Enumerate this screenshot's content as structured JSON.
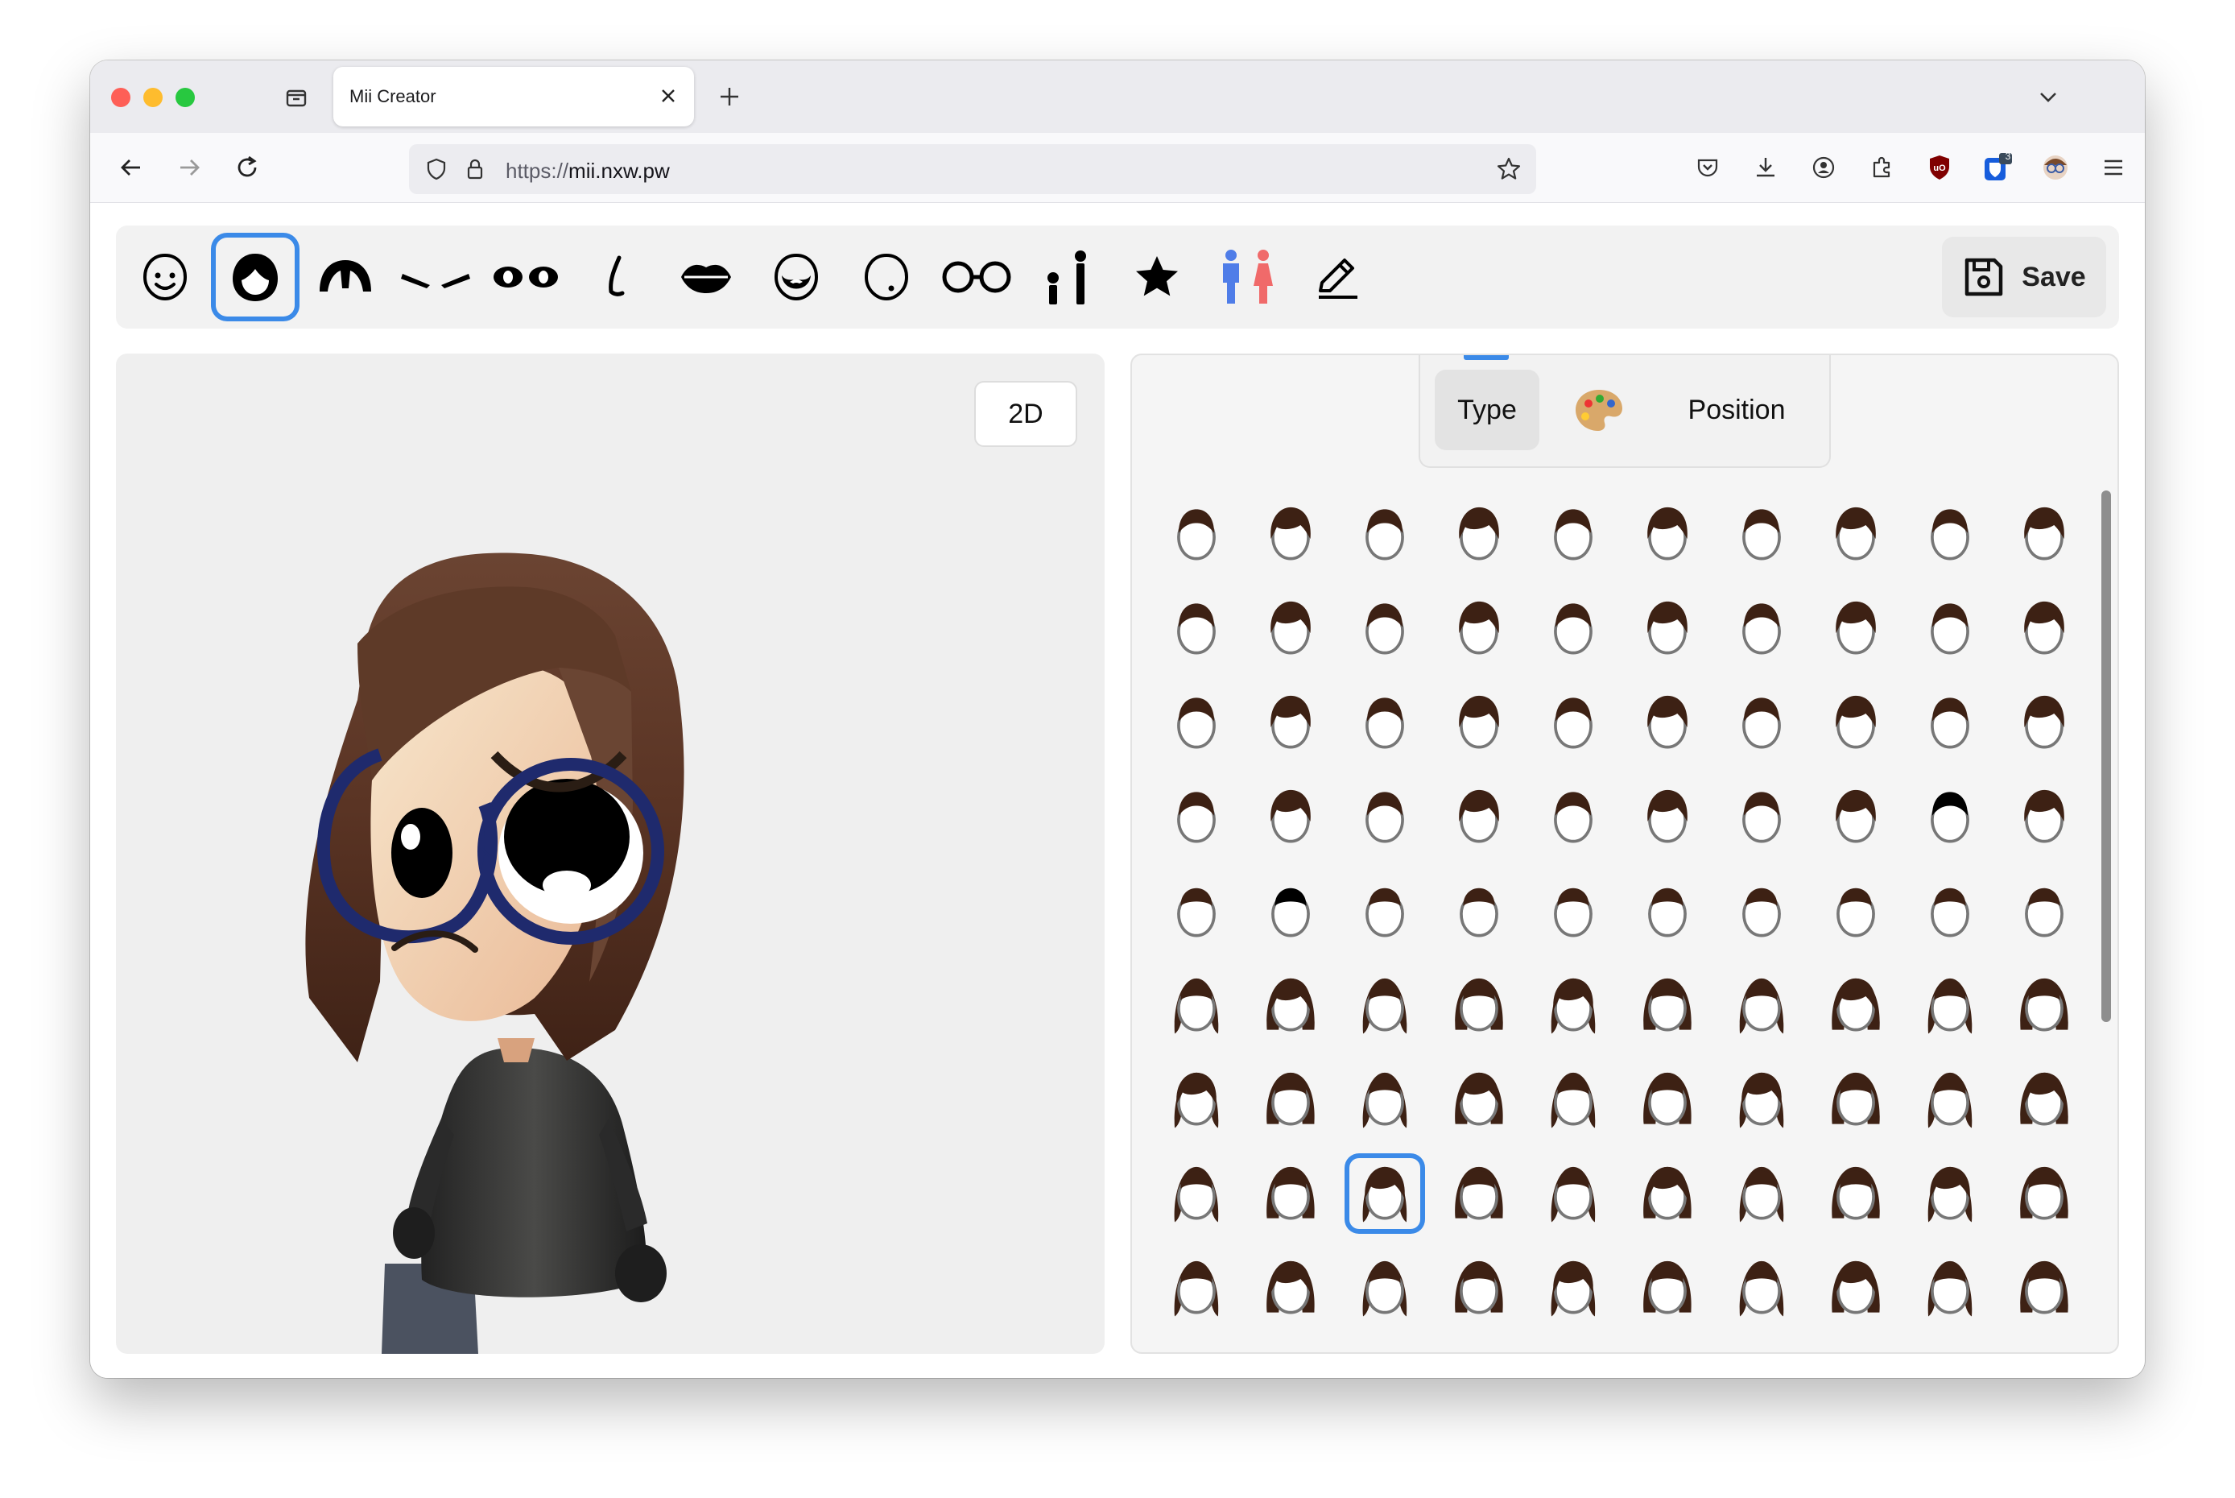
{
  "browser": {
    "tab_title": "Mii Creator",
    "url_scheme": "https://",
    "url_host": "mii.nxw.pw",
    "extension_badge": "3"
  },
  "toolbar": {
    "tools": [
      {
        "name": "face",
        "icon": "face-icon"
      },
      {
        "name": "hair",
        "icon": "hair-icon",
        "active": true
      },
      {
        "name": "eyebrows",
        "icon": "eyebrow-hair-icon"
      },
      {
        "name": "eyebrow",
        "icon": "eyebrows-icon"
      },
      {
        "name": "eyes",
        "icon": "eyes-icon"
      },
      {
        "name": "nose",
        "icon": "nose-icon"
      },
      {
        "name": "mouth",
        "icon": "mouth-icon"
      },
      {
        "name": "beard",
        "icon": "beard-icon"
      },
      {
        "name": "mole",
        "icon": "mole-icon"
      },
      {
        "name": "glasses",
        "icon": "glasses-icon"
      },
      {
        "name": "height",
        "icon": "height-icon"
      },
      {
        "name": "favorite",
        "icon": "star-icon"
      },
      {
        "name": "gender",
        "icon": "gender-icon"
      },
      {
        "name": "edit",
        "icon": "pencil-icon"
      }
    ],
    "save_label": "Save"
  },
  "preview": {
    "mode_button": "2D"
  },
  "panel": {
    "tabs": [
      {
        "label": "Type",
        "active": true
      },
      {
        "label": "",
        "icon": "palette-icon"
      },
      {
        "label": "Position"
      }
    ],
    "selected_index": 72
  },
  "colors": {
    "accent": "#3b8ae8",
    "hair": "#3d2114",
    "save_bg": "#e8e8e8"
  }
}
